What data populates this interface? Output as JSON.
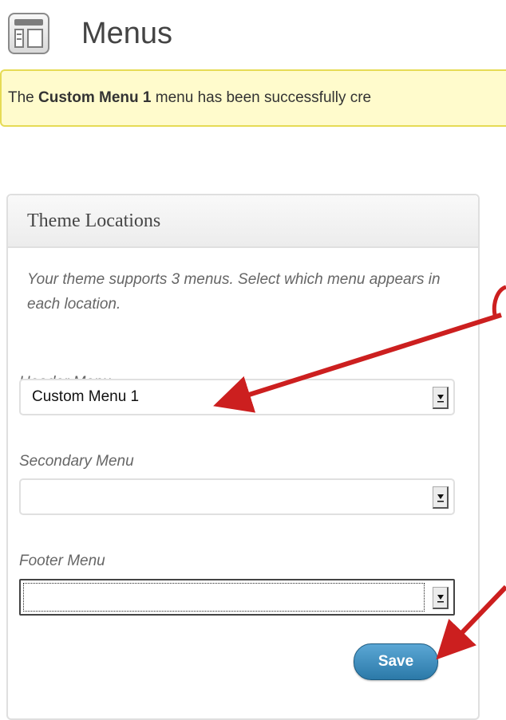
{
  "header": {
    "title": "Menus",
    "icon": "menus-icon"
  },
  "notice": {
    "prefix": "The ",
    "menu_name": "Custom Menu 1",
    "suffix": " menu has been successfully cre"
  },
  "theme_locations": {
    "heading": "Theme Locations",
    "description": "Your theme supports 3 menus. Select which menu appears in each location.",
    "fields": [
      {
        "label": "Header Menu",
        "value": "Custom Menu 1"
      },
      {
        "label": "Secondary Menu",
        "value": ""
      },
      {
        "label": "Footer Menu",
        "value": ""
      }
    ],
    "save_label": "Save"
  },
  "colors": {
    "annotation_arrow": "#cc1f1f",
    "notice_bg": "#fffbcc",
    "save_button": "#2e7db0"
  }
}
